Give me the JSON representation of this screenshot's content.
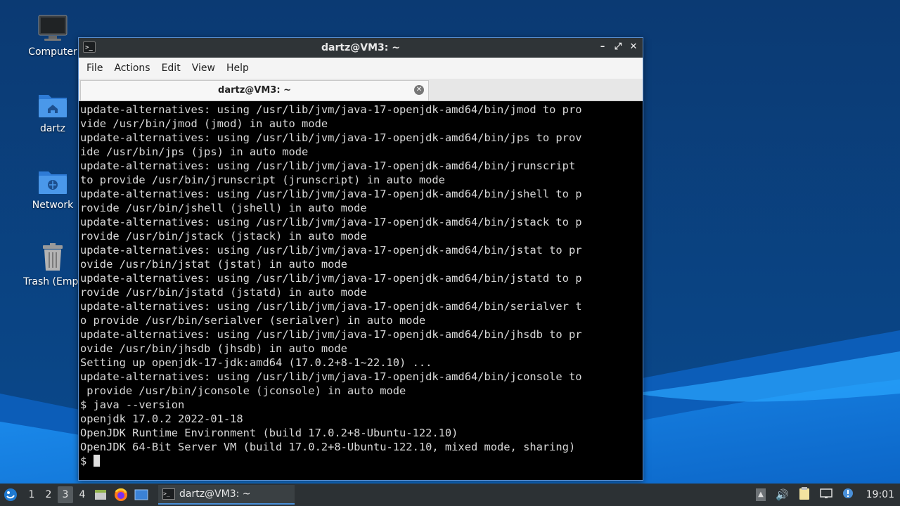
{
  "desktop": {
    "icons": [
      {
        "label": "Computer",
        "icon": "computer-icon"
      },
      {
        "label": "dartz",
        "icon": "home-folder-icon"
      },
      {
        "label": "Network",
        "icon": "network-folder-icon"
      },
      {
        "label": "Trash (Empt",
        "icon": "trash-icon"
      }
    ]
  },
  "window": {
    "title": "dartz@VM3: ~",
    "menu": [
      "File",
      "Actions",
      "Edit",
      "View",
      "Help"
    ],
    "tab_label": "dartz@VM3: ~",
    "controls": [
      "minimize-icon",
      "maximize-icon",
      "close-icon"
    ]
  },
  "terminal": {
    "lines": [
      "update-alternatives: using /usr/lib/jvm/java-17-openjdk-amd64/bin/jmod to pro",
      "vide /usr/bin/jmod (jmod) in auto mode",
      "update-alternatives: using /usr/lib/jvm/java-17-openjdk-amd64/bin/jps to prov",
      "ide /usr/bin/jps (jps) in auto mode",
      "update-alternatives: using /usr/lib/jvm/java-17-openjdk-amd64/bin/jrunscript",
      "to provide /usr/bin/jrunscript (jrunscript) in auto mode",
      "update-alternatives: using /usr/lib/jvm/java-17-openjdk-amd64/bin/jshell to p",
      "rovide /usr/bin/jshell (jshell) in auto mode",
      "update-alternatives: using /usr/lib/jvm/java-17-openjdk-amd64/bin/jstack to p",
      "rovide /usr/bin/jstack (jstack) in auto mode",
      "update-alternatives: using /usr/lib/jvm/java-17-openjdk-amd64/bin/jstat to pr",
      "ovide /usr/bin/jstat (jstat) in auto mode",
      "update-alternatives: using /usr/lib/jvm/java-17-openjdk-amd64/bin/jstatd to p",
      "rovide /usr/bin/jstatd (jstatd) in auto mode",
      "update-alternatives: using /usr/lib/jvm/java-17-openjdk-amd64/bin/serialver t",
      "o provide /usr/bin/serialver (serialver) in auto mode",
      "update-alternatives: using /usr/lib/jvm/java-17-openjdk-amd64/bin/jhsdb to pr",
      "ovide /usr/bin/jhsdb (jhsdb) in auto mode",
      "Setting up openjdk-17-jdk:amd64 (17.0.2+8-1~22.10) ...",
      "update-alternatives: using /usr/lib/jvm/java-17-openjdk-amd64/bin/jconsole to",
      " provide /usr/bin/jconsole (jconsole) in auto mode",
      "$ java --version",
      "openjdk 17.0.2 2022-01-18",
      "OpenJDK Runtime Environment (build 17.0.2+8-Ubuntu-122.10)",
      "OpenJDK 64-Bit Server VM (build 17.0.2+8-Ubuntu-122.10, mixed mode, sharing)"
    ],
    "prompt": "$ "
  },
  "taskbar": {
    "workspaces": [
      "1",
      "2",
      "3",
      "4"
    ],
    "active_workspace": "3",
    "task_label": "dartz@VM3: ~",
    "clock": "19:01"
  },
  "colors": {
    "accent": "#4a90d9",
    "taskbar_bg": "#2c3134",
    "terminal_bg": "#000000",
    "terminal_fg": "#d9d9d9"
  }
}
